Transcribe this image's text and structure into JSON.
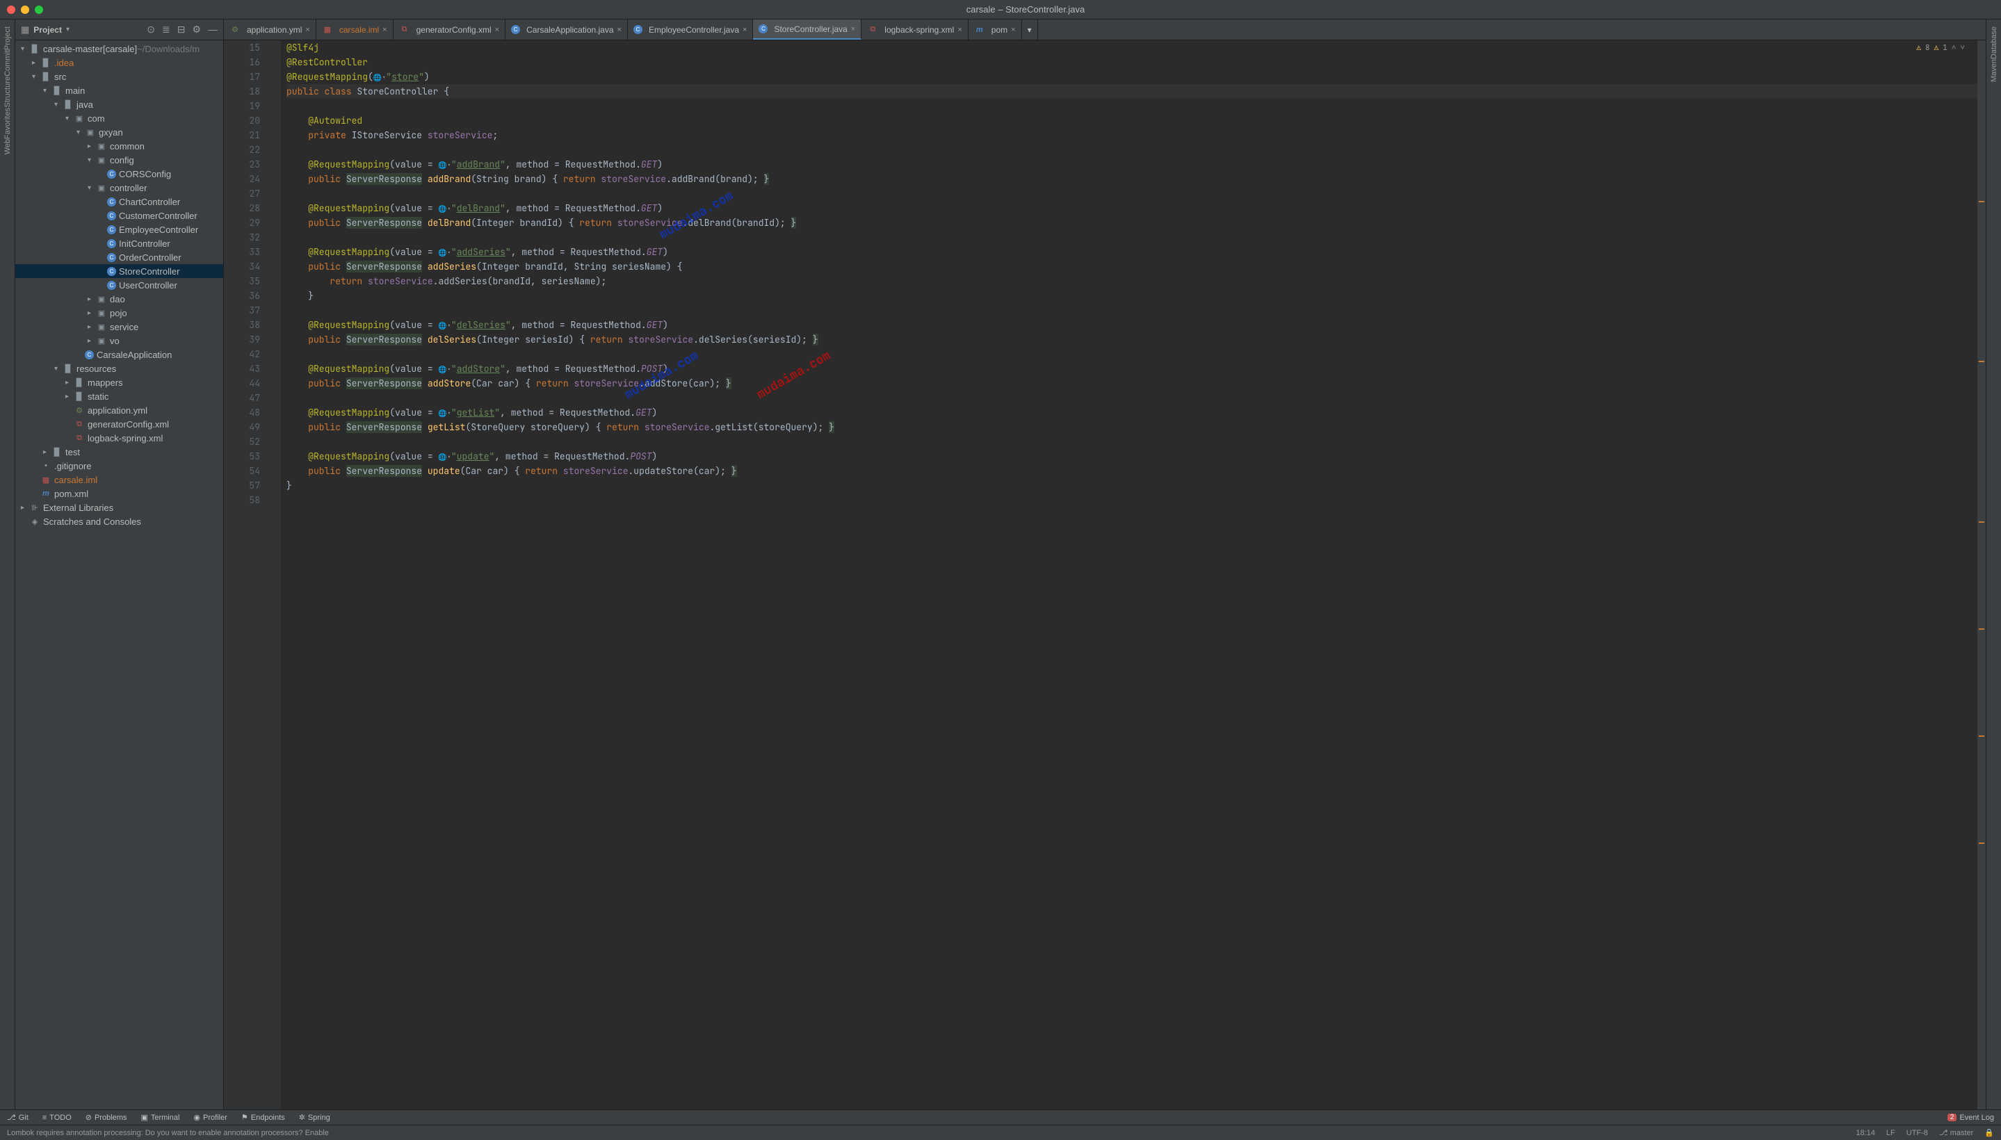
{
  "window": {
    "title": "carsale – StoreController.java"
  },
  "left_rail": [
    {
      "label": "Project"
    },
    {
      "label": "Commit"
    },
    {
      "label": "Structure"
    },
    {
      "label": "Favorites"
    },
    {
      "label": "Web"
    }
  ],
  "right_rail": [
    {
      "label": "Database"
    },
    {
      "label": "Maven"
    }
  ],
  "panel": {
    "title": "Project"
  },
  "tree": [
    {
      "indent": 0,
      "arrow": "▾",
      "icon": "folder",
      "label": "carsale-master",
      "suffix": " [carsale]",
      "muted": "  ~/Downloads/m"
    },
    {
      "indent": 1,
      "arrow": "▸",
      "icon": "folder",
      "label": ".idea",
      "orange": true
    },
    {
      "indent": 1,
      "arrow": "▾",
      "icon": "folder",
      "label": "src"
    },
    {
      "indent": 2,
      "arrow": "▾",
      "icon": "folder",
      "label": "main"
    },
    {
      "indent": 3,
      "arrow": "▾",
      "icon": "folder-src",
      "label": "java"
    },
    {
      "indent": 4,
      "arrow": "▾",
      "icon": "package",
      "label": "com"
    },
    {
      "indent": 5,
      "arrow": "▾",
      "icon": "package",
      "label": "gxyan"
    },
    {
      "indent": 6,
      "arrow": "▸",
      "icon": "package",
      "label": "common"
    },
    {
      "indent": 6,
      "arrow": "▾",
      "icon": "package",
      "label": "config"
    },
    {
      "indent": 7,
      "arrow": "",
      "icon": "class",
      "label": "CORSConfig"
    },
    {
      "indent": 6,
      "arrow": "▾",
      "icon": "package",
      "label": "controller"
    },
    {
      "indent": 7,
      "arrow": "",
      "icon": "class",
      "label": "ChartController"
    },
    {
      "indent": 7,
      "arrow": "",
      "icon": "class",
      "label": "CustomerController"
    },
    {
      "indent": 7,
      "arrow": "",
      "icon": "class",
      "label": "EmployeeController"
    },
    {
      "indent": 7,
      "arrow": "",
      "icon": "class",
      "label": "InitController"
    },
    {
      "indent": 7,
      "arrow": "",
      "icon": "class",
      "label": "OrderController"
    },
    {
      "indent": 7,
      "arrow": "",
      "icon": "class",
      "label": "StoreController",
      "selected": true
    },
    {
      "indent": 7,
      "arrow": "",
      "icon": "class",
      "label": "UserController"
    },
    {
      "indent": 6,
      "arrow": "▸",
      "icon": "package",
      "label": "dao"
    },
    {
      "indent": 6,
      "arrow": "▸",
      "icon": "package",
      "label": "pojo"
    },
    {
      "indent": 6,
      "arrow": "▸",
      "icon": "package",
      "label": "service"
    },
    {
      "indent": 6,
      "arrow": "▸",
      "icon": "package",
      "label": "vo"
    },
    {
      "indent": 5,
      "arrow": "",
      "icon": "class-run",
      "label": "CarsaleApplication"
    },
    {
      "indent": 3,
      "arrow": "▾",
      "icon": "folder-res",
      "label": "resources"
    },
    {
      "indent": 4,
      "arrow": "▸",
      "icon": "folder",
      "label": "mappers"
    },
    {
      "indent": 4,
      "arrow": "▸",
      "icon": "folder",
      "label": "static"
    },
    {
      "indent": 4,
      "arrow": "",
      "icon": "yml",
      "label": "application.yml"
    },
    {
      "indent": 4,
      "arrow": "",
      "icon": "xml",
      "label": "generatorConfig.xml"
    },
    {
      "indent": 4,
      "arrow": "",
      "icon": "xml",
      "label": "logback-spring.xml"
    },
    {
      "indent": 2,
      "arrow": "▸",
      "icon": "folder",
      "label": "test"
    },
    {
      "indent": 1,
      "arrow": "",
      "icon": "file",
      "label": ".gitignore"
    },
    {
      "indent": 1,
      "arrow": "",
      "icon": "iml",
      "label": "carsale.iml",
      "orange": true
    },
    {
      "indent": 1,
      "arrow": "",
      "icon": "maven",
      "label": "pom.xml"
    },
    {
      "indent": 0,
      "arrow": "▸",
      "icon": "lib",
      "label": "External Libraries"
    },
    {
      "indent": 0,
      "arrow": "",
      "icon": "scratch",
      "label": "Scratches and Consoles"
    }
  ],
  "tabs": [
    {
      "icon": "yml",
      "label": "application.yml"
    },
    {
      "icon": "iml",
      "label": "carsale.iml",
      "orange": true
    },
    {
      "icon": "xml",
      "label": "generatorConfig.xml"
    },
    {
      "icon": "class",
      "label": "CarsaleApplication.java"
    },
    {
      "icon": "class",
      "label": "EmployeeController.java"
    },
    {
      "icon": "class",
      "label": "StoreController.java",
      "active": true
    },
    {
      "icon": "xml",
      "label": "logback-spring.xml"
    },
    {
      "icon": "maven",
      "label": "pom"
    }
  ],
  "inspection": {
    "warnings": "8",
    "typos": "1"
  },
  "code_lines": [
    {
      "n": 15,
      "html": "<span class='hl-annotation'>@Slf4j</span>"
    },
    {
      "n": 16,
      "html": "<span class='hl-annotation'>@RestController</span>"
    },
    {
      "n": 17,
      "html": "<span class='hl-annotation'>@RequestMapping</span>(<span class='globe-icon'>🌐▾</span><span class='hl-string'>\"</span><span class='hl-string-u'>store</span><span class='hl-string'>\"</span>)"
    },
    {
      "n": 18,
      "html": "<span class='hl-keyword'>public class </span><span class='hl-class'>StoreController</span> {",
      "hl": true
    },
    {
      "n": 19,
      "html": ""
    },
    {
      "n": 20,
      "html": "    <span class='hl-annotation'>@Autowired</span>"
    },
    {
      "n": 21,
      "html": "    <span class='hl-keyword'>private</span> IStoreService <span class='hl-field'>storeService</span>;"
    },
    {
      "n": 22,
      "html": ""
    },
    {
      "n": 23,
      "html": "    <span class='hl-annotation'>@RequestMapping</span>(value = <span class='globe-icon'>🌐▾</span><span class='hl-string'>\"</span><span class='hl-string-u'>addBrand</span><span class='hl-string'>\"</span>, method = RequestMethod.<span class='hl-static'>GET</span>)"
    },
    {
      "n": 24,
      "html": "    <span class='hl-keyword'>public</span> <span class='hl-bg'>ServerResponse</span> <span class='hl-method'>addBrand</span>(String brand) { <span class='hl-keyword'>return</span> <span class='hl-field'>storeService</span>.addBrand(brand); <span class='hl-bg'>}</span>"
    },
    {
      "n": 27,
      "html": ""
    },
    {
      "n": 28,
      "html": "    <span class='hl-annotation'>@RequestMapping</span>(value = <span class='globe-icon'>🌐▾</span><span class='hl-string'>\"</span><span class='hl-string-u'>delBrand</span><span class='hl-string'>\"</span>, method = RequestMethod.<span class='hl-static'>GET</span>)"
    },
    {
      "n": 29,
      "html": "    <span class='hl-keyword'>public</span> <span class='hl-bg'>ServerResponse</span> <span class='hl-method'>delBrand</span>(Integer brandId) { <span class='hl-keyword'>return</span> <span class='hl-field'>storeService</span>.delBrand(brandId); <span class='hl-bg'>}</span>"
    },
    {
      "n": 32,
      "html": ""
    },
    {
      "n": 33,
      "html": "    <span class='hl-annotation'>@RequestMapping</span>(value = <span class='globe-icon'>🌐▾</span><span class='hl-string'>\"</span><span class='hl-string-u'>addSeries</span><span class='hl-string'>\"</span>, method = RequestMethod.<span class='hl-static'>GET</span>)"
    },
    {
      "n": 34,
      "html": "    <span class='hl-keyword'>public</span> <span class='hl-bg'>ServerResponse</span> <span class='hl-method'>addSeries</span>(Integer brandId, String seriesName) {"
    },
    {
      "n": 35,
      "html": "        <span class='hl-keyword'>return</span> <span class='hl-field'>storeService</span>.addSeries(brandId, seriesName);"
    },
    {
      "n": 36,
      "html": "    }"
    },
    {
      "n": 37,
      "html": ""
    },
    {
      "n": 38,
      "html": "    <span class='hl-annotation'>@RequestMapping</span>(value = <span class='globe-icon'>🌐▾</span><span class='hl-string'>\"</span><span class='hl-string-u'>delSeries</span><span class='hl-string'>\"</span>, method = RequestMethod.<span class='hl-static'>GET</span>)"
    },
    {
      "n": 39,
      "html": "    <span class='hl-keyword'>public</span> <span class='hl-bg'>ServerResponse</span> <span class='hl-method'>delSeries</span>(Integer seriesId) { <span class='hl-keyword'>return</span> <span class='hl-field'>storeService</span>.delSeries(seriesId); <span class='hl-bg'>}</span>"
    },
    {
      "n": 42,
      "html": ""
    },
    {
      "n": 43,
      "html": "    <span class='hl-annotation'>@RequestMapping</span>(value = <span class='globe-icon'>🌐▾</span><span class='hl-string'>\"</span><span class='hl-string-u'>addStore</span><span class='hl-string'>\"</span>, method = RequestMethod.<span class='hl-static'>POST</span>)"
    },
    {
      "n": 44,
      "html": "    <span class='hl-keyword'>public</span> <span class='hl-bg'>ServerResponse</span> <span class='hl-method'>addStore</span>(Car car) { <span class='hl-keyword'>return</span> <span class='hl-field'>storeService</span>.addStore(car); <span class='hl-bg'>}</span>"
    },
    {
      "n": 47,
      "html": ""
    },
    {
      "n": 48,
      "html": "    <span class='hl-annotation'>@RequestMapping</span>(value = <span class='globe-icon'>🌐▾</span><span class='hl-string'>\"</span><span class='hl-string-u'>getList</span><span class='hl-string'>\"</span>, method = RequestMethod.<span class='hl-static'>GET</span>)"
    },
    {
      "n": 49,
      "html": "    <span class='hl-keyword'>public</span> <span class='hl-bg'>ServerResponse</span> <span class='hl-method'>getList</span>(StoreQuery storeQuery) { <span class='hl-keyword'>return</span> <span class='hl-field'>storeService</span>.getList(storeQuery); <span class='hl-bg'>}</span>"
    },
    {
      "n": 52,
      "html": ""
    },
    {
      "n": 53,
      "html": "    <span class='hl-annotation'>@RequestMapping</span>(value = <span class='globe-icon'>🌐▾</span><span class='hl-string'>\"</span><span class='hl-string-u'>update</span><span class='hl-string'>\"</span>, method = RequestMethod.<span class='hl-static'>POST</span>)"
    },
    {
      "n": 54,
      "html": "    <span class='hl-keyword'>public</span> <span class='hl-bg'>ServerResponse</span> <span class='hl-method'>update</span>(Car car) { <span class='hl-keyword'>return</span> <span class='hl-field'>storeService</span>.updateStore(car); <span class='hl-bg'>}</span>"
    },
    {
      "n": 57,
      "html": "}"
    },
    {
      "n": 58,
      "html": ""
    }
  ],
  "toolwindows": [
    {
      "icon": "⎇",
      "label": "Git"
    },
    {
      "icon": "≡",
      "label": "TODO"
    },
    {
      "icon": "⊘",
      "label": "Problems"
    },
    {
      "icon": "▣",
      "label": "Terminal"
    },
    {
      "icon": "◉",
      "label": "Profiler"
    },
    {
      "icon": "⚑",
      "label": "Endpoints"
    },
    {
      "icon": "✲",
      "label": "Spring"
    }
  ],
  "event_log": {
    "count": "2",
    "label": "Event Log"
  },
  "statusbar": {
    "message": "Lombok requires annotation processing: Do you want to enable annotation processors? Enable",
    "pos": "18:14",
    "lf": "LF",
    "enc": "UTF-8",
    "branch": "master"
  }
}
